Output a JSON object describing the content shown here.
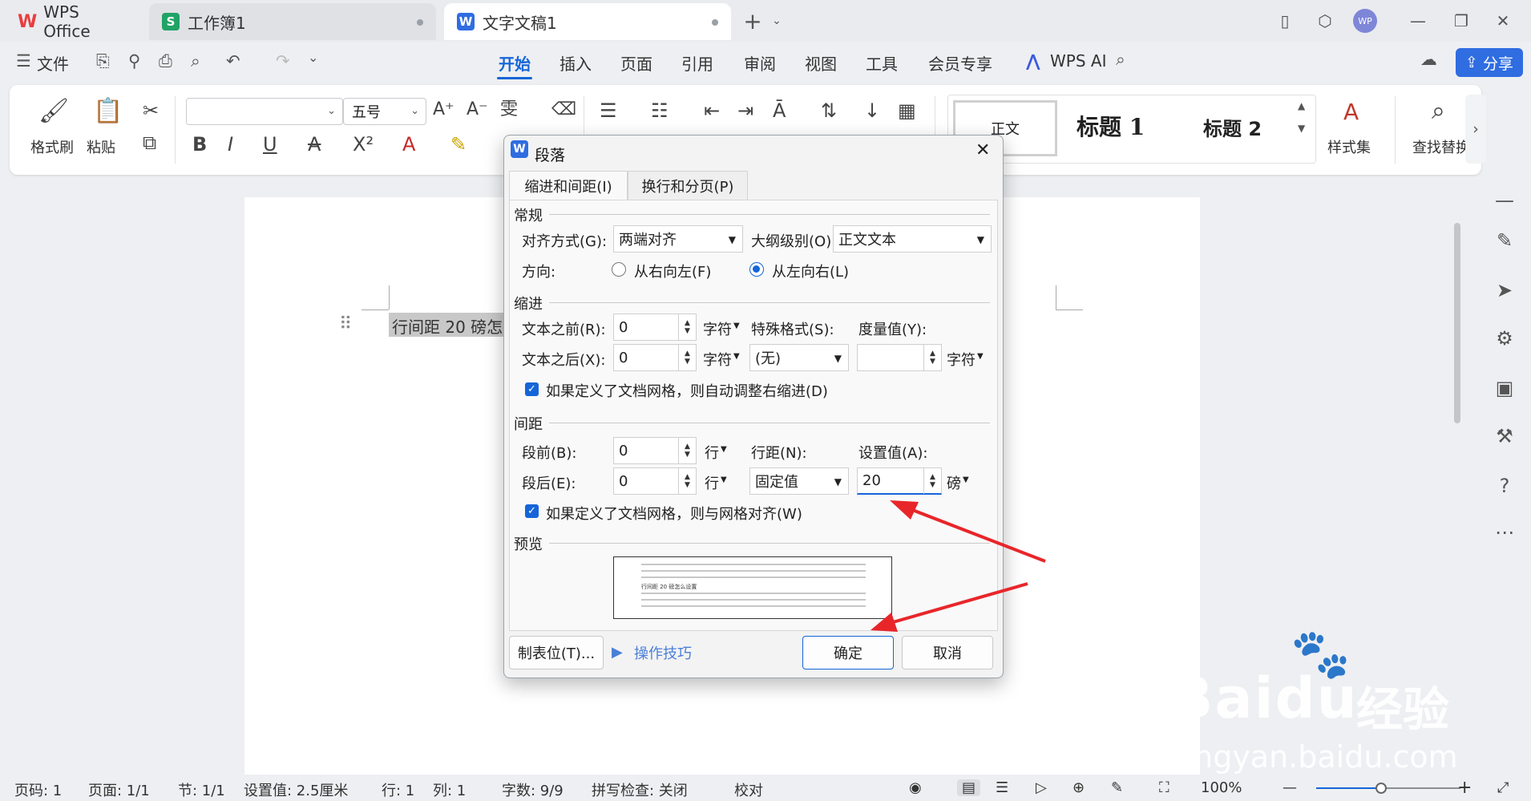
{
  "tabs": [
    {
      "label": "WPS Office",
      "icon": "wps-logo-icon"
    },
    {
      "label": "工作簿1",
      "icon": "spreadsheet-icon"
    },
    {
      "label": "文字文稿1",
      "icon": "writer-icon"
    }
  ],
  "avatar": "WP",
  "menu": {
    "file": "文件",
    "items": [
      "开始",
      "插入",
      "页面",
      "引用",
      "审阅",
      "视图",
      "工具",
      "会员专享"
    ],
    "ai": "WPS AI",
    "share": "分享"
  },
  "ribbon": {
    "format_painter": "格式刷",
    "paste": "粘贴",
    "font_size": "五号",
    "style_normal": "正文",
    "style_h1": "标题 1",
    "style_h2": "标题 2",
    "style_set": "样式集",
    "find_replace": "查找替换"
  },
  "document": {
    "text": "行间距 20 磅怎么"
  },
  "dialog": {
    "title": "段落",
    "tabs": [
      "缩进和间距(I)",
      "换行和分页(P)"
    ],
    "general": "常规",
    "align_label": "对齐方式(G):",
    "align_value": "两端对齐",
    "outline_label": "大纲级别(O):",
    "outline_value": "正文文本",
    "direction_label": "方向:",
    "rtl": "从右向左(F)",
    "ltr": "从左向右(L)",
    "indent": "缩进",
    "before_text_label": "文本之前(R):",
    "before_text_value": "0",
    "after_text_label": "文本之后(X):",
    "after_text_value": "0",
    "unit_char": "字符",
    "special_label": "特殊格式(S):",
    "special_value": "(无)",
    "measure_label": "度量值(Y):",
    "auto_indent_check": "如果定义了文档网格，则自动调整右缩进(D)",
    "spacing": "间距",
    "before_label": "段前(B):",
    "before_value": "0",
    "after_label": "段后(E):",
    "after_value": "0",
    "unit_line": "行",
    "line_spacing_label": "行距(N):",
    "line_spacing_value": "固定值",
    "set_value_label": "设置值(A):",
    "set_value": "20",
    "unit_pt": "磅",
    "grid_check": "如果定义了文档网格，则与网格对齐(W)",
    "preview_label": "预览",
    "preview_text": "行间距 20 磅怎么设置",
    "tabstop_button": "制表位(T)...",
    "tips_link": "操作技巧",
    "ok_button": "确定",
    "cancel_button": "取消"
  },
  "status": {
    "page_no": "页码: 1",
    "pages": "页面: 1/1",
    "section": "节: 1/1",
    "setting": "设置值: 2.5厘米",
    "row": "行: 1",
    "col": "列: 1",
    "words": "字数: 9/9",
    "spell": "拼写检查: 关闭",
    "proof": "校对",
    "zoom": "100%"
  },
  "watermark": {
    "brand": "Bai",
    "brand2": "du",
    "cn": "经验",
    "url": "jingyan.baidu.com"
  },
  "colors": {
    "accent": "#1565d8",
    "annotation_arrow": "#e8262a",
    "wps_red": "#e83e3e",
    "sheet_green": "#21a366"
  }
}
